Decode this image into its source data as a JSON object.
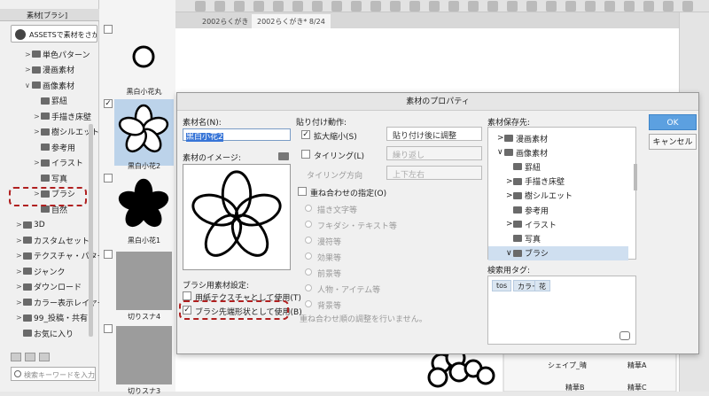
{
  "left_panel": {
    "tab_label": "素材[ブラシ]",
    "assets_button": "ASSETSで素材をさがす",
    "tree": [
      {
        "label": "単色パターン",
        "arrow": ">"
      },
      {
        "label": "漫画素材",
        "arrow": ">"
      },
      {
        "label": "画像素材",
        "arrow": "∨"
      },
      {
        "label": "罫紐",
        "arrow": ""
      },
      {
        "label": "手描き床壁",
        "arrow": ">"
      },
      {
        "label": "樹シルエット",
        "arrow": ">"
      },
      {
        "label": "参考用",
        "arrow": ""
      },
      {
        "label": "イラスト",
        "arrow": ">"
      },
      {
        "label": "写真",
        "arrow": ""
      },
      {
        "label": "ブラシ",
        "arrow": ">"
      },
      {
        "label": "自然",
        "arrow": ""
      },
      {
        "label": "3D",
        "arrow": ">"
      },
      {
        "label": "カスタムセット",
        "arrow": ">"
      },
      {
        "label": "テクスチャ・パターン",
        "arrow": ">"
      },
      {
        "label": "ジャンク",
        "arrow": ">"
      },
      {
        "label": "ダウンロード",
        "arrow": ">"
      },
      {
        "label": "カラー表示レイヤー",
        "arrow": ">"
      },
      {
        "label": "99_投稿・共有",
        "arrow": ">"
      },
      {
        "label": "お気に入り",
        "arrow": ""
      }
    ],
    "search_placeholder": "検索キーワードを入力..."
  },
  "thumbnails": [
    {
      "name": "黒白小花丸",
      "checked": false
    },
    {
      "name": "黒白小花2",
      "checked": true
    },
    {
      "name": "黒白小花1",
      "checked": false
    },
    {
      "name": "切りスナ4",
      "checked": false
    },
    {
      "name": "切りスナ3",
      "checked": false
    }
  ],
  "tabs": [
    {
      "label": "2002らくがき"
    },
    {
      "label": "2002らくがき* 8/24"
    }
  ],
  "dialog": {
    "title": "素材のプロパティ",
    "name_label": "素材名(N):",
    "name_value": "黒白小花2",
    "image_label": "素材のイメージ:",
    "brush_settings_label": "ブラシ用素材設定:",
    "use_paper_texture": "用紙テクスチャとして使用(T)",
    "use_brush_tip": "ブラシ先端形状として使用(B)",
    "paste_label": "貼り付け動作:",
    "scale_label": "拡大縮小(S)",
    "scale_dropdown": "貼り付け後に調整",
    "tiling_label": "タイリング(L)",
    "tiling_dropdown": "繰り返し",
    "tiling_dir_label": "タイリング方向",
    "tiling_dir_dropdown": "上下左右",
    "overlay_label": "重ね合わせの指定(O)",
    "radios": [
      "描き文字等",
      "フキダシ・テキスト等",
      "漫符等",
      "効果等",
      "前景等",
      "人物・アイテム等",
      "背景等"
    ],
    "overlay_note": "重ね合わせ順の調整を行いません。",
    "storage_label": "素材保存先:",
    "storage_items": [
      {
        "label": "漫画素材",
        "indent": 1,
        "arrow": ">"
      },
      {
        "label": "画像素材",
        "indent": 1,
        "arrow": "∨"
      },
      {
        "label": "罫紐",
        "indent": 2,
        "arrow": ""
      },
      {
        "label": "手描き床壁",
        "indent": 2,
        "arrow": ">"
      },
      {
        "label": "樹シルエット",
        "indent": 2,
        "arrow": ">"
      },
      {
        "label": "参考用",
        "indent": 2,
        "arrow": ""
      },
      {
        "label": "イラスト",
        "indent": 2,
        "arrow": ">"
      },
      {
        "label": "写真",
        "indent": 2,
        "arrow": ""
      },
      {
        "label": "ブラシ",
        "indent": 2,
        "arrow": "∨"
      }
    ],
    "tags_label": "検索用タグ:",
    "tags": [
      "tos",
      "カラー",
      "花"
    ],
    "ok": "OK",
    "cancel": "キャンセル"
  },
  "background_labels": [
    "シェイプ_晴",
    "精華A",
    "精華B",
    "精華C"
  ],
  "colors": {
    "accent": "#5ca0e0",
    "highlight": "#b02020",
    "selection": "#bcd3ea"
  }
}
